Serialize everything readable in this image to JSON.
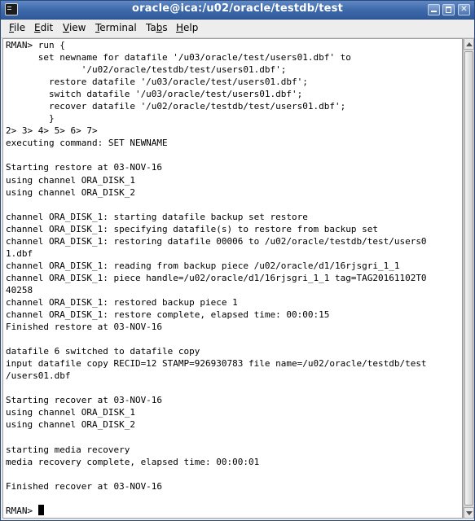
{
  "window": {
    "title": "oracle@ica:/u02/oracle/testdb/test"
  },
  "menu": [
    {
      "label": "File",
      "mnemonic": "F",
      "rest": "ile"
    },
    {
      "label": "Edit",
      "mnemonic": "E",
      "rest": "dit"
    },
    {
      "label": "View",
      "mnemonic": "V",
      "rest": "iew"
    },
    {
      "label": "Terminal",
      "mnemonic": "T",
      "rest": "erminal"
    },
    {
      "label": "Tabs",
      "mnemonic": "b",
      "pre": "Ta",
      "rest": "s"
    },
    {
      "label": "Help",
      "mnemonic": "H",
      "rest": "elp"
    }
  ],
  "terminal": {
    "lines": [
      "RMAN> run {",
      "      set newname for datafile '/u03/oracle/test/users01.dbf' to",
      "              '/u02/oracle/testdb/test/users01.dbf';",
      "        restore datafile '/u03/oracle/test/users01.dbf';",
      "        switch datafile '/u03/oracle/test/users01.dbf';",
      "        recover datafile '/u02/oracle/testdb/test/users01.dbf';",
      "        }",
      "2> 3> 4> 5> 6> 7>",
      "executing command: SET NEWNAME",
      "",
      "Starting restore at 03-NOV-16",
      "using channel ORA_DISK_1",
      "using channel ORA_DISK_2",
      "",
      "channel ORA_DISK_1: starting datafile backup set restore",
      "channel ORA_DISK_1: specifying datafile(s) to restore from backup set",
      "channel ORA_DISK_1: restoring datafile 00006 to /u02/oracle/testdb/test/users0",
      "1.dbf",
      "channel ORA_DISK_1: reading from backup piece /u02/oracle/d1/16rjsgri_1_1",
      "channel ORA_DISK_1: piece handle=/u02/oracle/d1/16rjsgri_1_1 tag=TAG20161102T0",
      "40258",
      "channel ORA_DISK_1: restored backup piece 1",
      "channel ORA_DISK_1: restore complete, elapsed time: 00:00:15",
      "Finished restore at 03-NOV-16",
      "",
      "datafile 6 switched to datafile copy",
      "input datafile copy RECID=12 STAMP=926930783 file name=/u02/oracle/testdb/test",
      "/users01.dbf",
      "",
      "Starting recover at 03-NOV-16",
      "using channel ORA_DISK_1",
      "using channel ORA_DISK_2",
      "",
      "starting media recovery",
      "media recovery complete, elapsed time: 00:00:01",
      "",
      "Finished recover at 03-NOV-16",
      "",
      "RMAN> "
    ]
  }
}
